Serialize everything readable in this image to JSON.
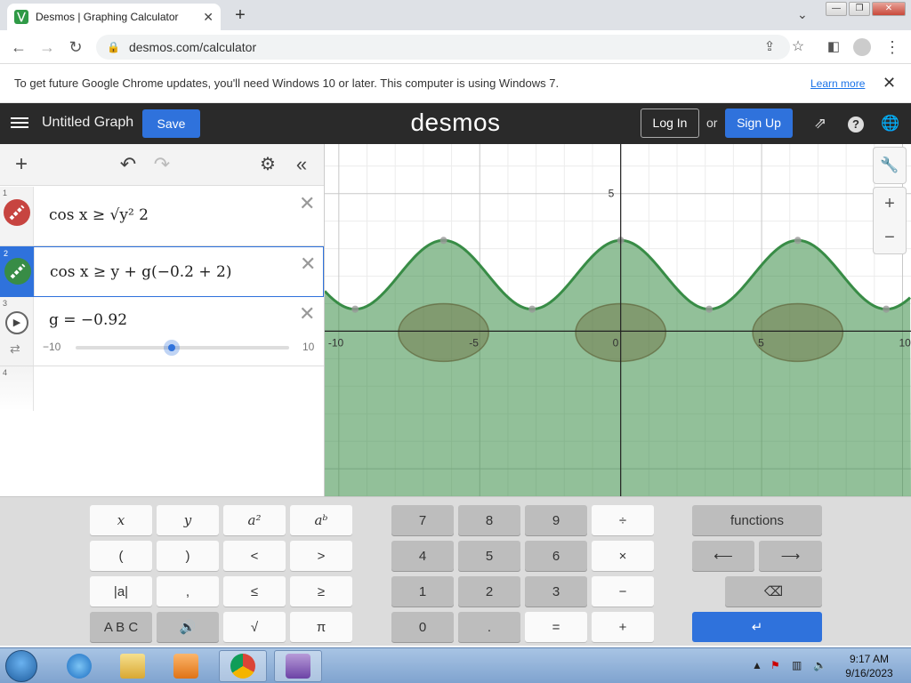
{
  "browser": {
    "tab_title": "Desmos | Graphing Calculator",
    "new_tab": "+",
    "url": "desmos.com/calculator",
    "win_minimize": "—",
    "win_restore": "❐",
    "win_close": "✕"
  },
  "infobar": {
    "message": "To get future Google Chrome updates, you'll need Windows 10 or later. This computer is using Windows 7.",
    "learn_more": "Learn more",
    "close": "✕"
  },
  "header": {
    "graph_title": "Untitled Graph",
    "save": "Save",
    "logo": "desmos",
    "login": "Log In",
    "or": "or",
    "signup": "Sign Up"
  },
  "expressions": [
    {
      "num": "1",
      "color": "#c74440",
      "text": "cos x ≥ √y² 2"
    },
    {
      "num": "2",
      "color": "#388c46",
      "text": "cos x ≥ y + g(−0.2 + 2)"
    },
    {
      "num": "3",
      "text": "g = −0.92",
      "slider_min": "−10",
      "slider_max": "10",
      "value": -0.92
    },
    {
      "num": "4"
    }
  ],
  "graph": {
    "x_ticks": [
      "-10",
      "-5",
      "0",
      "5",
      "10"
    ],
    "y_ticks": [
      "5"
    ],
    "xlim": [
      -10.5,
      10.3
    ],
    "ylim": [
      -6,
      6.8
    ],
    "fill_color": "#388c46",
    "curve_color": "#388c46"
  },
  "keypad": {
    "math_keys": [
      "x",
      "y",
      "a²",
      "aᵇ",
      "(",
      ")",
      "<",
      ">",
      "|a|",
      ",",
      "≤",
      "≥",
      "A B C",
      "🔊",
      "√",
      "π"
    ],
    "num_keys": [
      "7",
      "8",
      "9",
      "÷",
      "4",
      "5",
      "6",
      "×",
      "1",
      "2",
      "3",
      "−",
      "0",
      ".",
      "=",
      "+"
    ],
    "functions": "functions",
    "left": "⟵",
    "right": "⟶",
    "backspace": "⌫",
    "enter": "↵"
  },
  "taskbar": {
    "time": "9:17 AM",
    "date": "9/16/2023"
  }
}
